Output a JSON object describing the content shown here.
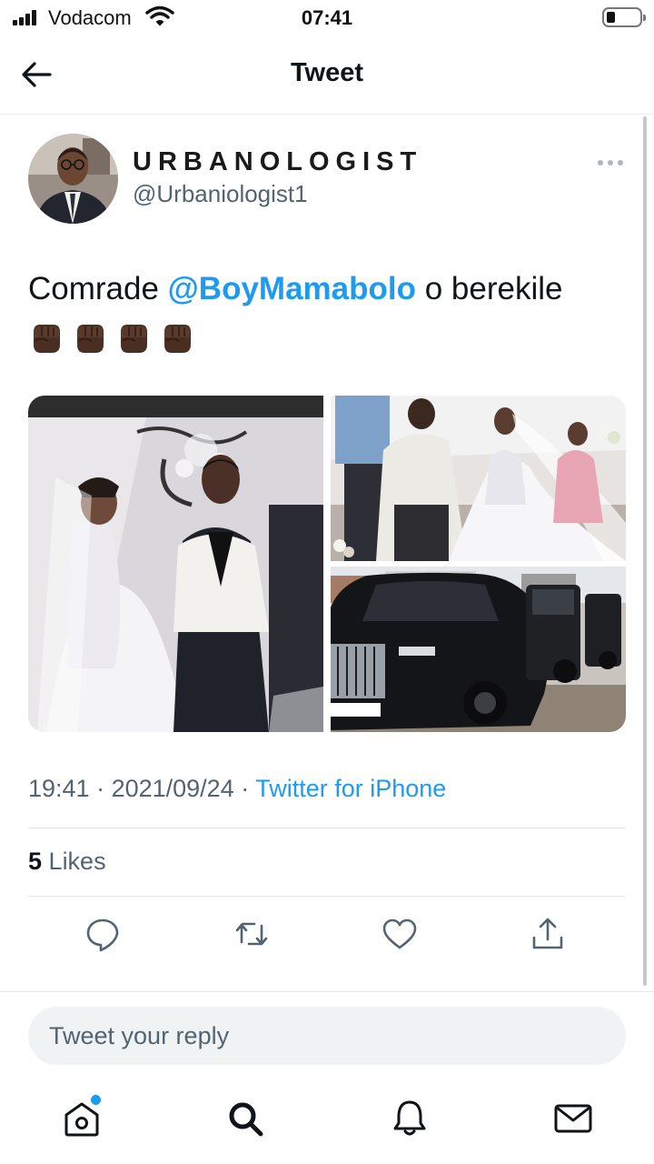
{
  "status_bar": {
    "carrier": "Vodacom",
    "time": "07:41"
  },
  "header": {
    "title": "Tweet",
    "back_icon": "arrow-left-icon"
  },
  "tweet": {
    "author": {
      "display_name": "URBANOLOGIST",
      "handle": "@Urbaniologist1"
    },
    "text_before": "Comrade ",
    "mention": "@BoyMamabolo",
    "text_after": " o berekile",
    "emoji": "raised-fist-dark-skin-tone x4",
    "media": [
      {
        "name": "wedding-couple-photo"
      },
      {
        "name": "wedding-procession-photo"
      },
      {
        "name": "black-cars-photo"
      }
    ],
    "time": "19:41",
    "separator": " · ",
    "date": "2021/09/24",
    "source": "Twitter for iPhone",
    "likes_count": "5",
    "likes_label": "Likes"
  },
  "actions": [
    "reply-icon",
    "retweet-icon",
    "like-icon",
    "share-icon"
  ],
  "reply": {
    "placeholder": "Tweet your reply"
  },
  "nav": [
    "home-icon",
    "search-icon",
    "notifications-icon",
    "messages-icon"
  ],
  "colors": {
    "accent": "#1d9bf0",
    "text": "#0f1419",
    "secondary": "#536471"
  }
}
